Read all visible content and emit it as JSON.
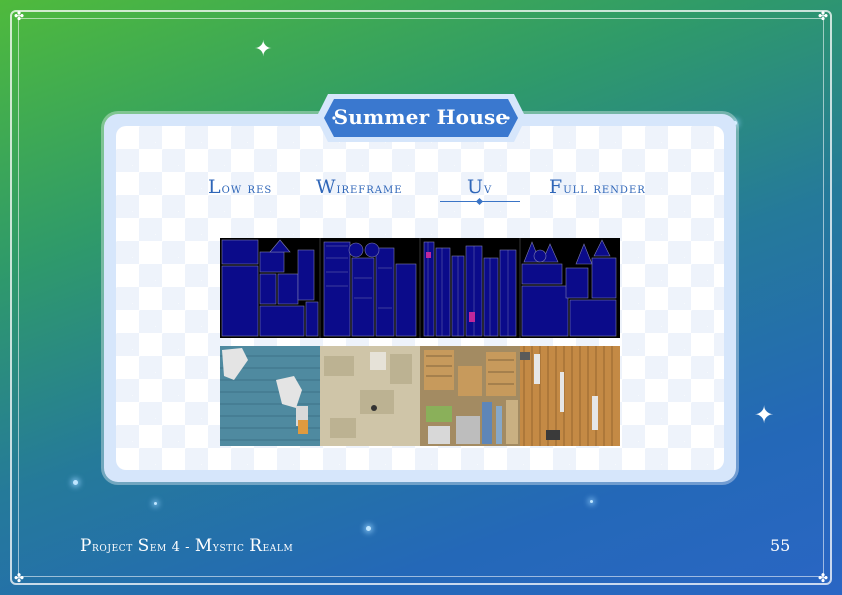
{
  "slide": {
    "title": "Summer House",
    "tabs": [
      {
        "first": "L",
        "rest": "ow res"
      },
      {
        "first": "W",
        "rest": "ireframe"
      },
      {
        "first": "U",
        "rest": "v"
      },
      {
        "first": "F",
        "rest": "ull render"
      }
    ],
    "active_tab_index": 2,
    "images": {
      "uv_layout_strip": "uv-layout-panels",
      "textured_uv_strip": "textured-uv-panels"
    }
  },
  "footer": {
    "project_first": "P",
    "project_rest": "roject ",
    "sem_first": "S",
    "sem_rest": "em 4 - ",
    "mystic_first": "M",
    "mystic_rest": "ystic ",
    "realm_first": "R",
    "realm_rest": "ealm",
    "page_number": "55"
  },
  "colors": {
    "accent": "#2f66b8",
    "badge": "#3a78cf",
    "uv_background": "#0b0b8a"
  }
}
